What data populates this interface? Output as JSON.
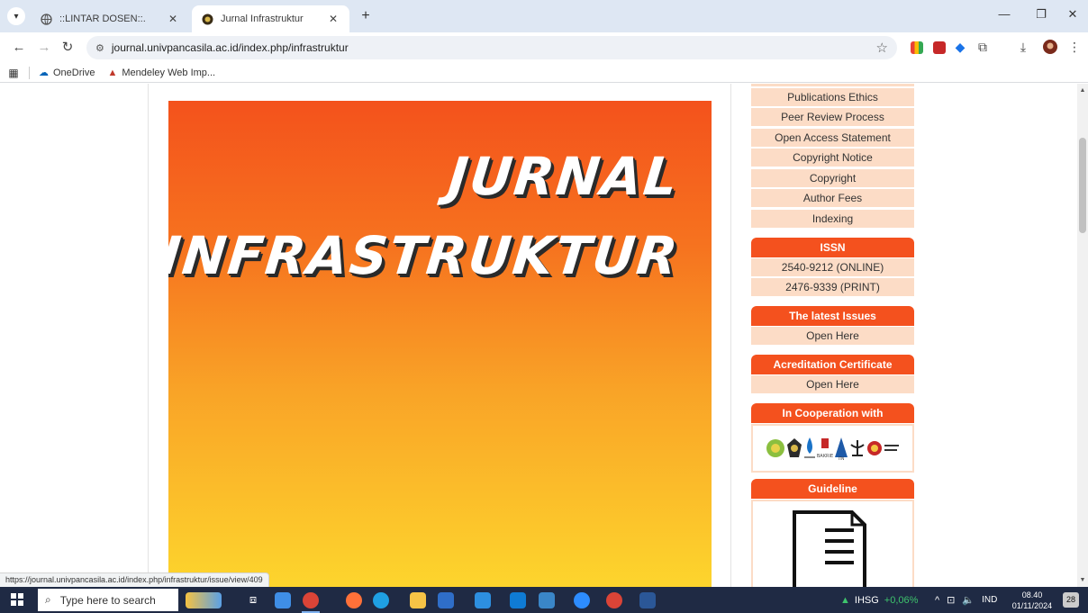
{
  "browser": {
    "tabs": [
      {
        "title": "::LINTAR DOSEN::.",
        "active": false
      },
      {
        "title": "Jurnal Infrastruktur",
        "active": true
      }
    ],
    "url": "journal.univpancasila.ac.id/index.php/infrastruktur",
    "bookmarks": [
      {
        "label": "OneDrive",
        "icon": "cloud-icon"
      },
      {
        "label": "Mendeley Web Imp...",
        "icon": "mendeley-icon"
      }
    ],
    "status_url": "https://journal.univpancasila.ac.id/index.php/infrastruktur/issue/view/409"
  },
  "cover": {
    "line1": "JURNAL",
    "line2": "INFRASTRUKTUR"
  },
  "sidebar": {
    "menu": [
      "Publications Ethics",
      "Peer Review Process",
      "Open Access Statement",
      "Copyright Notice",
      "Copyright",
      "Author Fees",
      "Indexing"
    ],
    "issn": {
      "heading": "ISSN",
      "online": "2540-9212 (ONLINE)",
      "print": "2476-9339 (PRINT)"
    },
    "latest": {
      "heading": "The latest Issues",
      "link": "Open Here"
    },
    "accreditation": {
      "heading": "Acreditation Certificate",
      "link": "Open Here"
    },
    "cooperation": {
      "heading": "In Cooperation with"
    },
    "guideline": {
      "heading": "Guideline"
    }
  },
  "taskbar": {
    "search_placeholder": "Type here to search",
    "stock_label": "IHSG",
    "stock_change": "+0,06%",
    "language": "IND",
    "time": "08.40",
    "date": "01/11/2024",
    "notifications": "28"
  },
  "colors": {
    "accent": "#f4511e",
    "menu_bg": "#fcdcc6",
    "chrome_bg": "#dee7f3",
    "taskbar_bg": "#1f2a44"
  }
}
